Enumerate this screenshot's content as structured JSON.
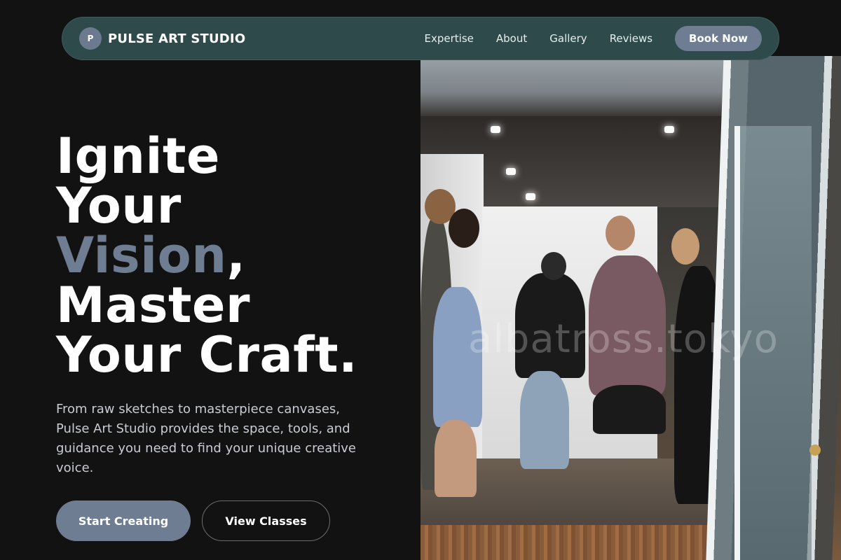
{
  "nav": {
    "logo_initial": "P",
    "logo_text": "PULSE ART STUDIO",
    "links": [
      "Expertise",
      "About",
      "Gallery",
      "Reviews"
    ],
    "cta": "Book Now"
  },
  "hero": {
    "headline_line1": "Ignite",
    "headline_line2": "Your",
    "headline_accent": "Vision",
    "headline_comma": ",",
    "headline_line4": "Master",
    "headline_line5": "Your Craft.",
    "description": "From raw sketches to masterpiece canvases, Pulse Art Studio provides the space, tools, and guidance you need to find your unique creative voice.",
    "primary_button": "Start Creating",
    "secondary_button": "View Classes"
  },
  "photo": {
    "watermark": "albatross.tokyo"
  },
  "colors": {
    "background": "#121213",
    "accent": "#6e7d92",
    "nav_bg": "#2e4a4a"
  },
  "icons": {
    "logo": "logo-badge-icon"
  }
}
